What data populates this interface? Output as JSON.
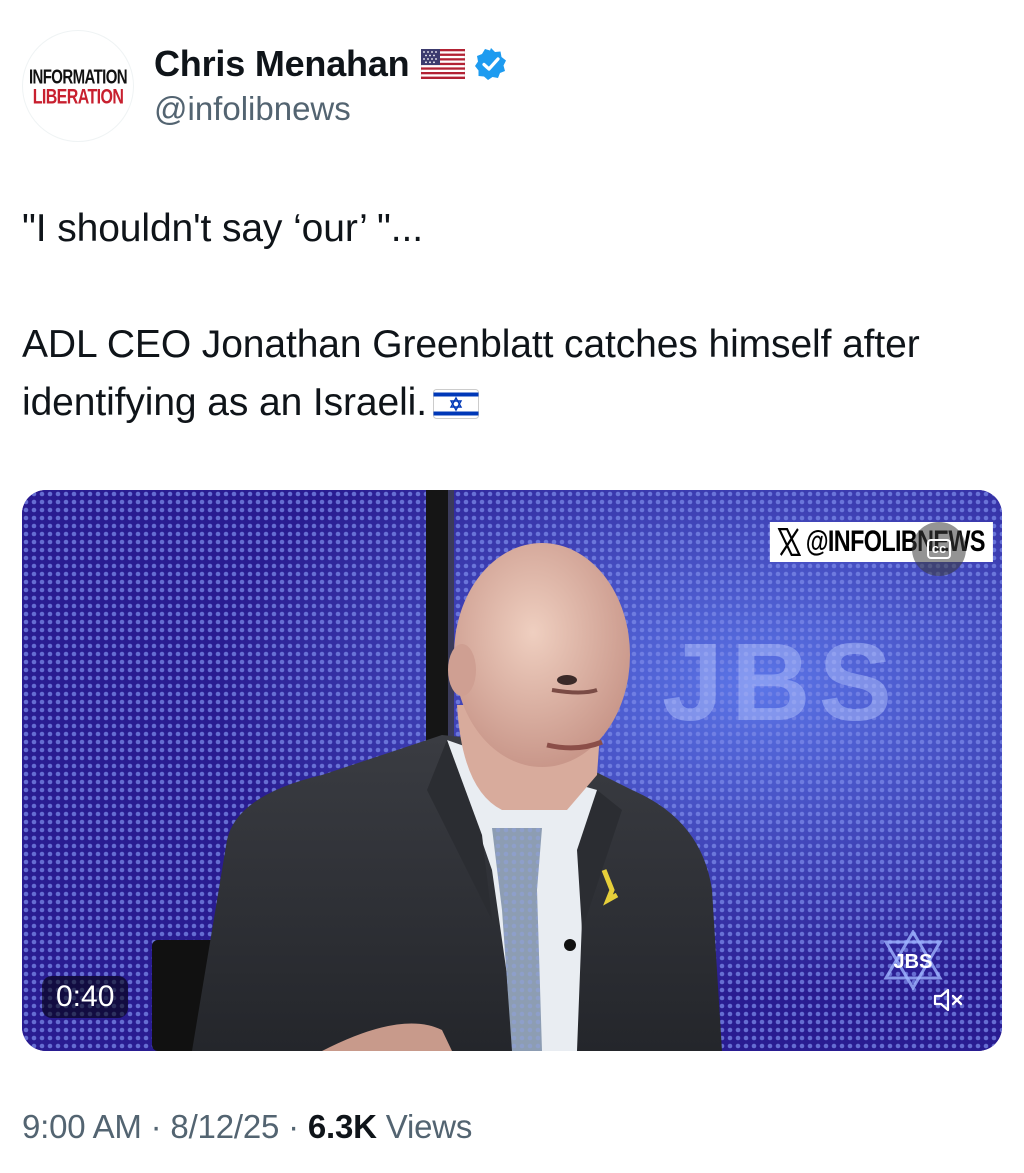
{
  "author": {
    "avatar_line1": "INFORMATION",
    "avatar_line2": "LIBERATION",
    "name": "Chris Menahan",
    "handle": "@infolibnews",
    "flag_icon": "us-flag-icon",
    "verified_icon": "verified-badge-icon",
    "verified_color": "#1d9bf0"
  },
  "tweet": {
    "line1": "\"I shouldn't say ‘our’ \"...",
    "line2": "ADL CEO Jonathan Greenblatt catches himself after identifying as an Israeli.",
    "trailing_icon": "israel-flag-icon"
  },
  "video": {
    "watermark": "@INFOLIBNEWS",
    "watermark_icon": "x-logo-icon",
    "duration": "0:40",
    "channel_logo_text": "JBS",
    "cc_icon": "cc-icon",
    "mute_icon": "speaker-muted-icon"
  },
  "meta": {
    "time": "9:00 AM",
    "sep1": " · ",
    "date": "8/12/25",
    "sep2": " · ",
    "views_count": "6.3K",
    "views_label": " Views"
  }
}
